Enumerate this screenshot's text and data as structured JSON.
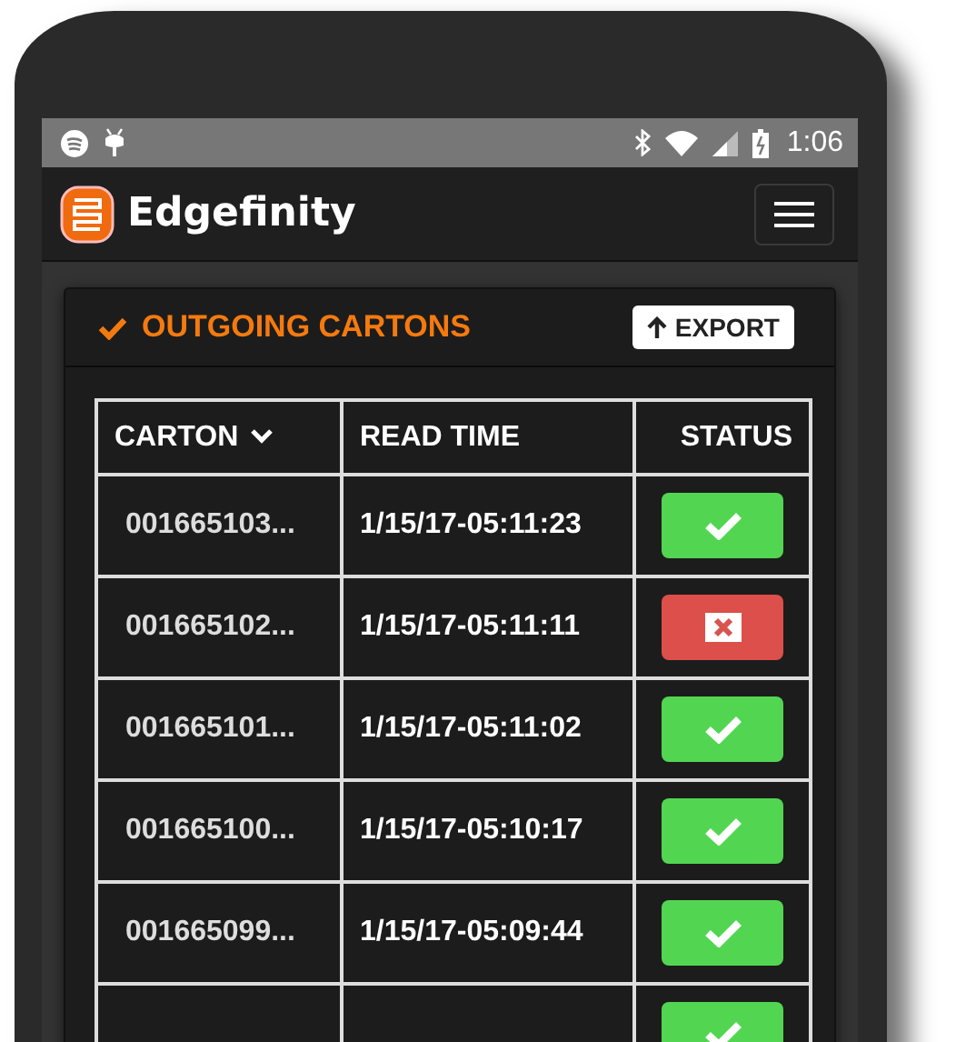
{
  "status_bar": {
    "time": "1:06"
  },
  "app_bar": {
    "title": "Edgefinity"
  },
  "card": {
    "title": "OUTGOING CARTONS",
    "export_button": "EXPORT",
    "table": {
      "columns": [
        "CARTON",
        "READ TIME",
        "STATUS"
      ],
      "rows": [
        {
          "carton": "001665103...",
          "read_time": "1/15/17-05:11:23",
          "kind": "ok"
        },
        {
          "carton": "001665102...",
          "read_time": "1/15/17-05:11:11",
          "kind": "error"
        },
        {
          "carton": "001665101...",
          "read_time": "1/15/17-05:11:02",
          "kind": "ok"
        },
        {
          "carton": "001665100...",
          "read_time": "1/15/17-05:10:17",
          "kind": "ok"
        },
        {
          "carton": "001665099...",
          "read_time": "1/15/17-05:09:44",
          "kind": "ok"
        },
        {
          "kind": "ok"
        }
      ]
    }
  }
}
